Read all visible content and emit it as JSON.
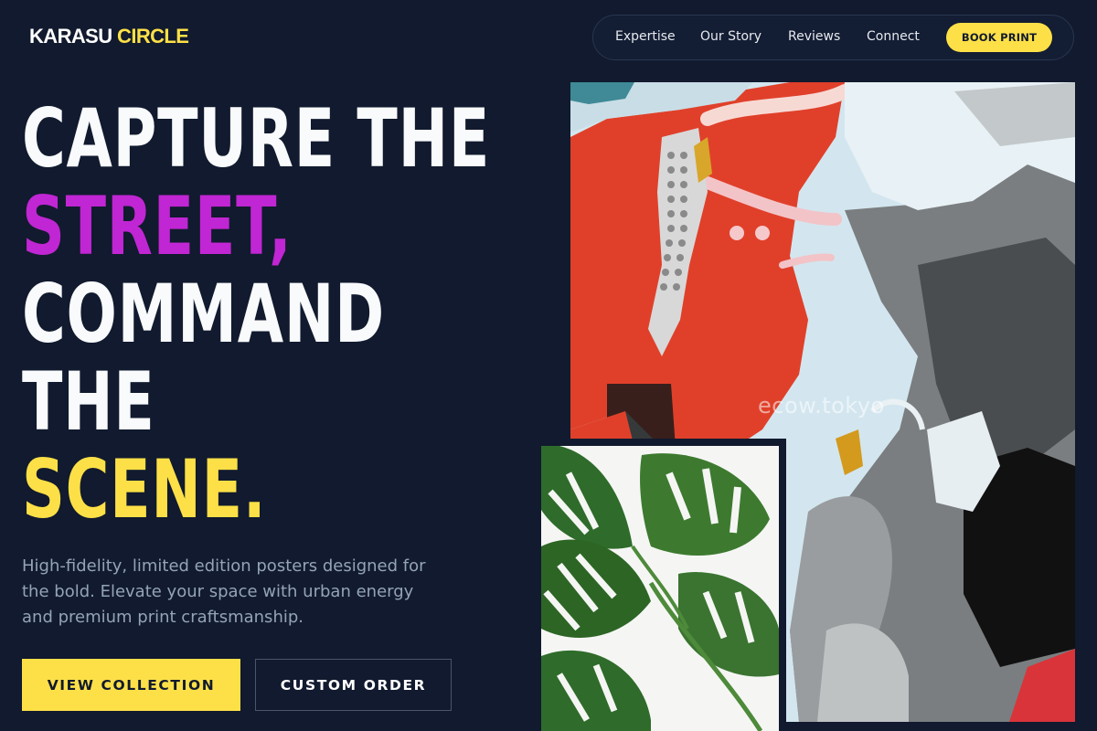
{
  "brand": {
    "name_part1": "KARASU",
    "name_part2": "CIRCLE"
  },
  "nav": {
    "links": [
      "Expertise",
      "Our Story",
      "Reviews",
      "Connect"
    ],
    "cta": "BOOK PRINT"
  },
  "hero": {
    "line1": "CAPTURE THE",
    "line2": "STREET,",
    "line3": "COMMAND",
    "line4": "THE",
    "line5": "SCENE.",
    "subtext": "High-fidelity, limited edition posters designed for the bold. Elevate your space with urban energy and premium print craftsmanship.",
    "primary_button": "VIEW COLLECTION",
    "secondary_button": "CUSTOM ORDER"
  },
  "images": {
    "main_poster_watermark": "ecow.tokyo"
  },
  "colors": {
    "background": "#111a2e",
    "accent_yellow": "#fde047",
    "accent_purple": "#c026d3",
    "muted_text": "#94a3b8"
  }
}
